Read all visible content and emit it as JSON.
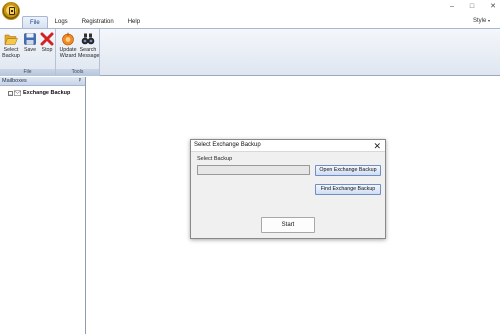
{
  "titlebar": {
    "caption": "",
    "controls": [
      "–",
      "□",
      "✕"
    ]
  },
  "menu": {
    "tabs": [
      {
        "label": "File",
        "active": true
      },
      {
        "label": "Logs",
        "active": false
      },
      {
        "label": "Registration",
        "active": false
      },
      {
        "label": "Help",
        "active": false
      }
    ],
    "style_label": "Style"
  },
  "ribbon": {
    "groups": [
      {
        "label": "File",
        "buttons": [
          {
            "label": "Select Backup",
            "icon": "folder-open-icon"
          },
          {
            "label": "Save",
            "icon": "save-icon"
          },
          {
            "label": "Stop",
            "icon": "stop-icon"
          }
        ]
      },
      {
        "label": "Tools",
        "buttons": [
          {
            "label": "Update Wizard",
            "icon": "update-icon"
          },
          {
            "label": "Search Message",
            "icon": "binoculars-icon"
          }
        ]
      }
    ]
  },
  "left_panel": {
    "header": "Mailboxes",
    "pin": "ᵖ",
    "tree": [
      {
        "label": "Exchange Backup",
        "toggle": "–",
        "bold": true
      }
    ]
  },
  "dialog": {
    "title": "Select Exchange Backup",
    "close": "✕",
    "field_label": "Select Backup",
    "field_value": "",
    "open_button": "Open Exchange Backup",
    "find_button": "Find Exchange Backup",
    "start_button": "Start"
  },
  "colors": {
    "accent": "#1a3f80",
    "ribbon_bg": "#dfe6f0",
    "button_border": "#6f8fc4",
    "stop_red": "#d32020"
  }
}
